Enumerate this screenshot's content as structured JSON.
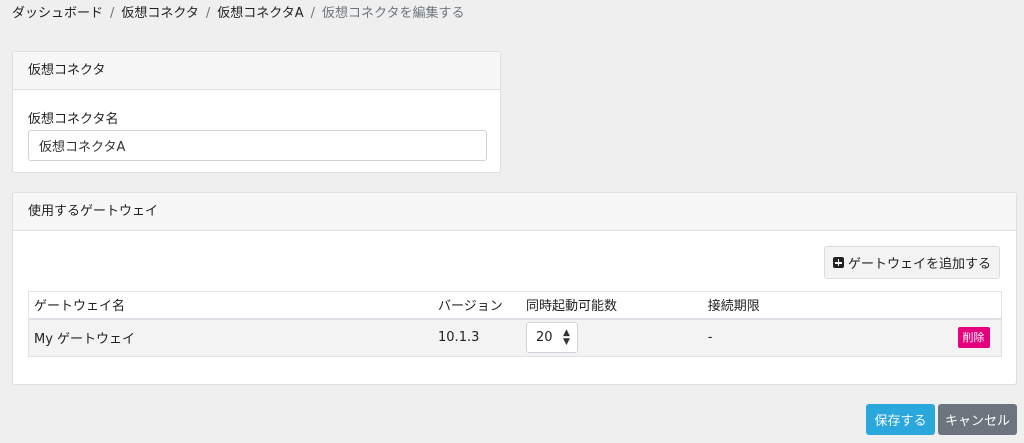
{
  "breadcrumb": {
    "items": [
      "ダッシュボード",
      "仮想コネクタ",
      "仮想コネクタA"
    ],
    "current": "仮想コネクタを編集する",
    "separator": "/"
  },
  "connector_card": {
    "title": "仮想コネクタ",
    "name_label": "仮想コネクタ名",
    "name_value": "仮想コネクタA"
  },
  "gateways_card": {
    "title": "使用するゲートウェイ",
    "add_button_label": "ゲートウェイを追加する",
    "columns": {
      "name": "ゲートウェイ名",
      "version": "バージョン",
      "concurrency": "同時起動可能数",
      "expiry": "接続期限"
    },
    "rows": [
      {
        "name": "My ゲートウェイ",
        "version": "10.1.3",
        "concurrency": "20",
        "expiry": "-",
        "delete_label": "削除"
      }
    ]
  },
  "actions": {
    "save_label": "保存する",
    "cancel_label": "キャンセル"
  },
  "colors": {
    "primary": "#2aa7dc",
    "secondary": "#6c757d",
    "danger": "#e6007e",
    "background": "#efefef"
  }
}
